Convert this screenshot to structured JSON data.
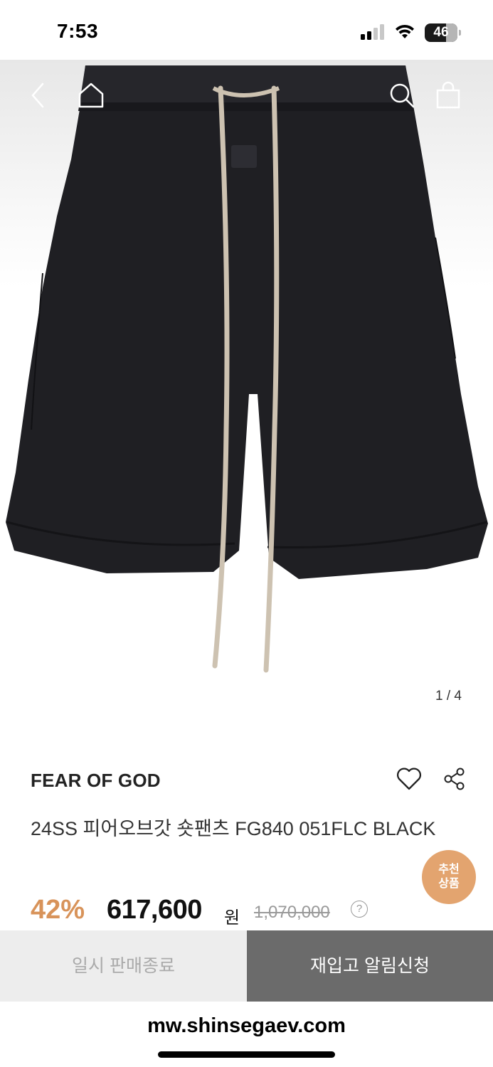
{
  "status_bar": {
    "time": "7:53",
    "battery": "46"
  },
  "gallery": {
    "counter": "1 / 4",
    "product_color": "#1f1f23",
    "drawstring_color": "#cdc2b1"
  },
  "nav": {
    "back_icon": "chevron-left-icon",
    "home_icon": "home-icon",
    "search_icon": "search-icon",
    "bag_icon": "shopping-bag-icon"
  },
  "product": {
    "brand": "FEAR OF GOD",
    "title": "24SS 피어오브갓 숏팬츠 FG840 051FLC BLACK",
    "discount": "42%",
    "price": "617,600",
    "currency": "원",
    "original_price": "1,070,000",
    "help_mark": "?"
  },
  "recommend_badge": {
    "line1": "추천",
    "line2": "상품"
  },
  "actions": {
    "sold_out_label": "일시 판매종료",
    "restock_label": "재입고 알림신청"
  },
  "browser": {
    "url": "mw.shinsegaev.com"
  },
  "colors": {
    "accent": "#d8935a",
    "badge": "#e3a46f",
    "restock_button": "#6b6b6b"
  }
}
